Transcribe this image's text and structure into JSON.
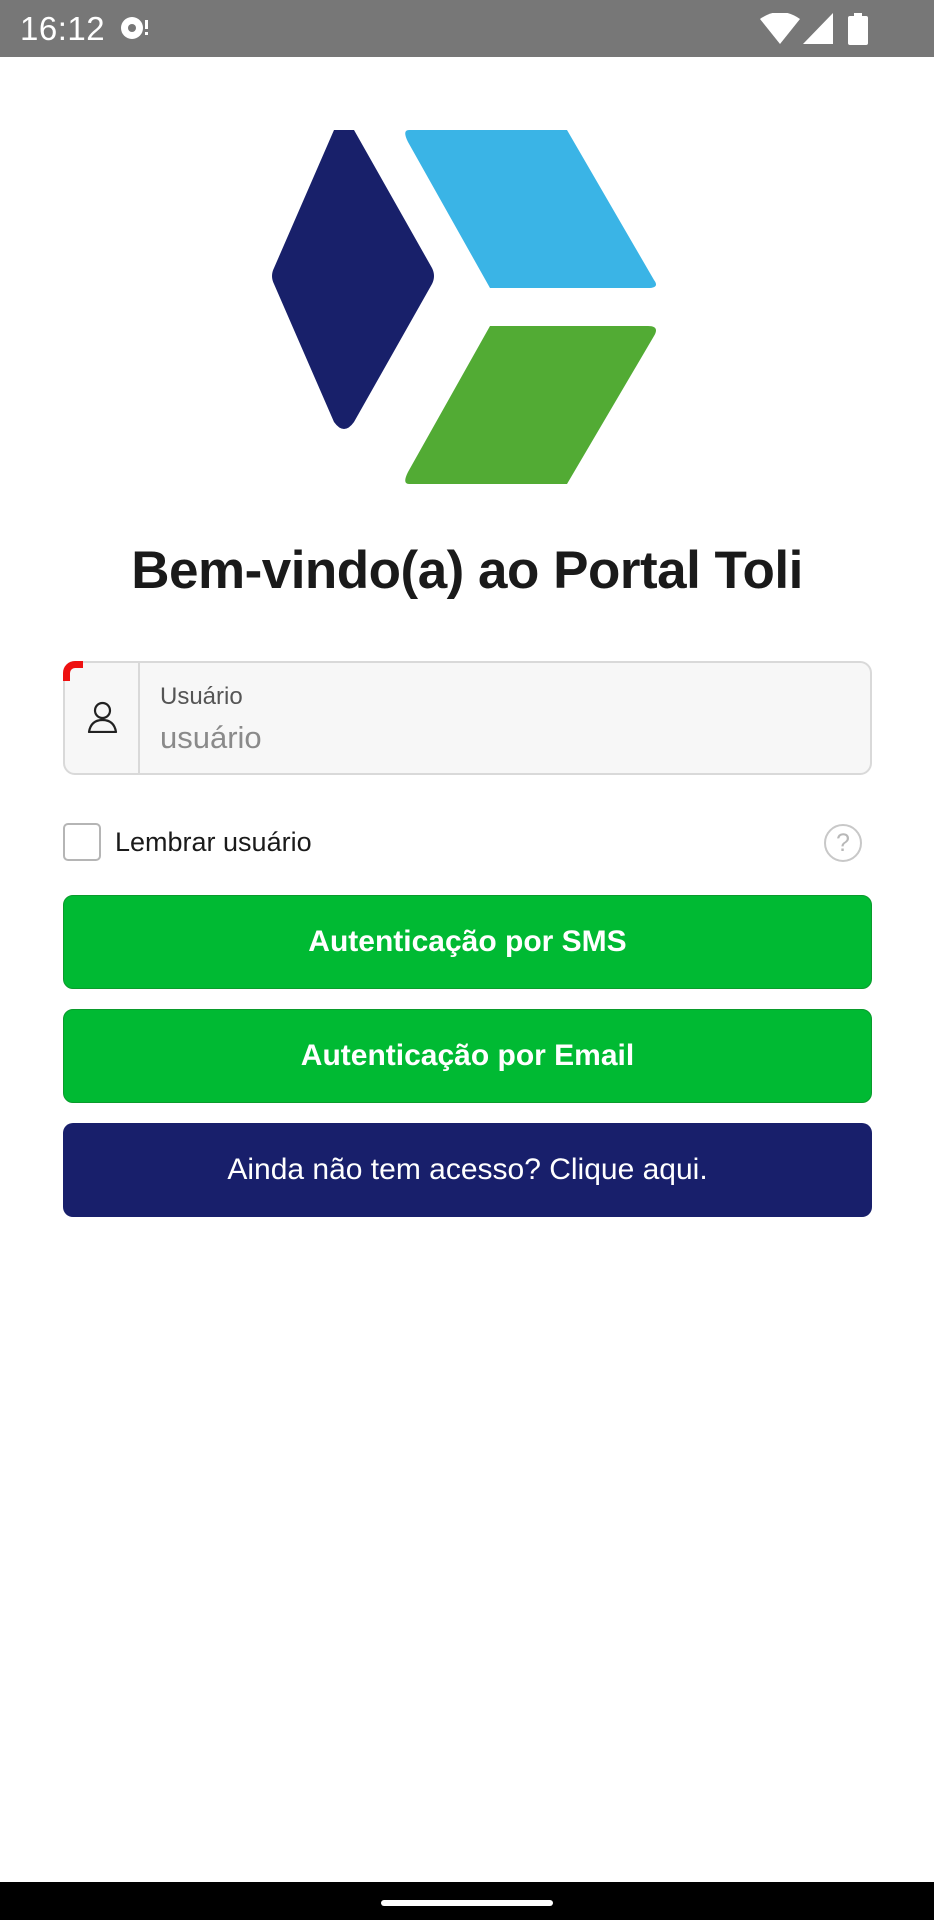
{
  "status_bar": {
    "time": "16:12"
  },
  "welcome": {
    "title": "Bem-vindo(a) ao Portal Toli"
  },
  "login": {
    "user_label": "Usuário",
    "user_placeholder": "usuário",
    "user_value": "",
    "remember_label": "Lembrar usuário",
    "remember_checked": false,
    "help_symbol": "?"
  },
  "buttons": {
    "sms_label": "Autenticação por SMS",
    "email_label": "Autenticação por Email",
    "access_label": "Ainda não tem acesso? Clique aqui."
  },
  "icons": {
    "user": "user-icon",
    "help": "help-icon",
    "sync": "sync-icon",
    "wifi": "wifi-icon",
    "signal": "signal-icon",
    "battery": "battery-icon"
  },
  "colors": {
    "primary_green": "#00ba33",
    "navy": "#181f6b",
    "logo_navy": "#18206a",
    "logo_light_blue": "#3ab4e6",
    "logo_green": "#52ab34",
    "required_marker": "#ee1111"
  }
}
